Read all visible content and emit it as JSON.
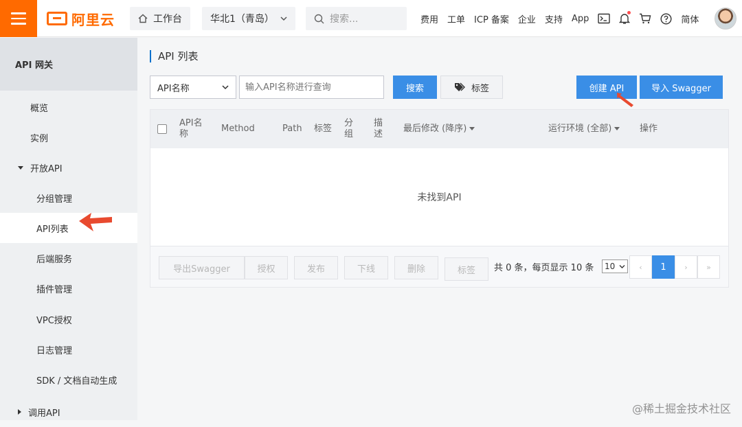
{
  "topbar": {
    "menu_icon": "hamburger-icon",
    "logo_text": "阿里云",
    "workbench_label": "工作台",
    "region_label": "华北1（青岛）",
    "search_placeholder": "搜索...",
    "links": [
      "费用",
      "工单",
      "ICP 备案",
      "企业",
      "支持",
      "App"
    ],
    "language": "简体"
  },
  "sidebar": {
    "title": "API 网关",
    "items": [
      {
        "label": "概览"
      },
      {
        "label": "实例"
      },
      {
        "label": "开放API"
      },
      {
        "label": "分组管理"
      },
      {
        "label": "API列表"
      },
      {
        "label": "后端服务"
      },
      {
        "label": "插件管理"
      },
      {
        "label": "VPC授权"
      },
      {
        "label": "日志管理"
      },
      {
        "label": "SDK / 文档自动生成"
      },
      {
        "label": "调用API"
      }
    ]
  },
  "main": {
    "title": "API 列表",
    "filter_select": "API名称",
    "query_placeholder": "输入API名称进行查询",
    "search_button": "搜索",
    "tag_button": "标签",
    "create_button": "创建 API",
    "import_button": "导入 Swagger",
    "columns": [
      "API名称",
      "Method",
      "Path",
      "标签",
      "分组",
      "描述",
      "最后修改 (降序)",
      "运行环境 (全部)",
      "操作"
    ],
    "empty_text": "未找到API",
    "footer_buttons": [
      "导出Swagger",
      "授权",
      "发布",
      "下线",
      "删除",
      "标签"
    ],
    "summary": "共 0 条，每页显示 10 条",
    "page_size": "10",
    "pagination": {
      "prev2": "‹",
      "current": "1",
      "next": "›",
      "last": "»"
    }
  },
  "colors": {
    "accent": "#ff6a00",
    "primary": "#3a8ee6",
    "annotation_arrow": "#e84a2f"
  },
  "watermark": "@稀土掘金技术社区"
}
